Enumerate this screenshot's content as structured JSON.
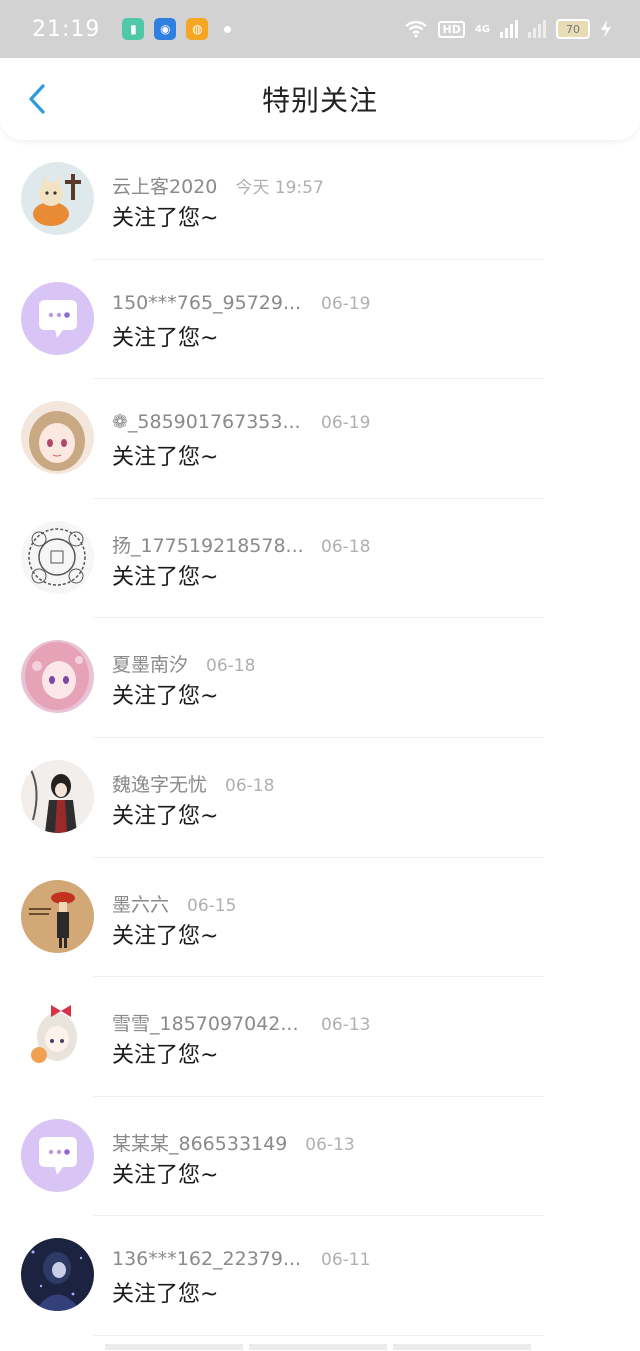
{
  "status_bar": {
    "time": "21:19",
    "network_label": "4G",
    "hd_label": "HD",
    "battery": "70"
  },
  "header": {
    "title": "特别关注"
  },
  "items": [
    {
      "name": "云上客2020",
      "time": "今天 19:57",
      "message": "关注了您~",
      "avatar": "cat-pumpkin"
    },
    {
      "name": "150***765_95729...",
      "time": "06-19",
      "message": "关注了您~",
      "avatar": "default-chat"
    },
    {
      "name": "❁_585901767353...",
      "time": "06-19",
      "message": "关注了您~",
      "avatar": "anime-girl"
    },
    {
      "name": "扬_177519218578...",
      "time": "06-18",
      "message": "关注了您~",
      "avatar": "pattern"
    },
    {
      "name": "夏墨南汐",
      "time": "06-18",
      "message": "关注了您~",
      "avatar": "anime-pink"
    },
    {
      "name": "魏逸字无忧",
      "time": "06-18",
      "message": "关注了您~",
      "avatar": "ink-figure"
    },
    {
      "name": "墨六六",
      "time": "06-15",
      "message": "关注了您~",
      "avatar": "beret-figure"
    },
    {
      "name": "雪雪_1857097042...",
      "time": "06-13",
      "message": "关注了您~",
      "avatar": "anime-bow"
    },
    {
      "name": "某某某_866533149",
      "time": "06-13",
      "message": "关注了您~",
      "avatar": "default-chat"
    },
    {
      "name": "136***162_22379...",
      "time": "06-11",
      "message": "关注了您~",
      "avatar": "dark-night"
    }
  ],
  "colors": {
    "status_bar": "#d2d2d2",
    "accent_back": "#2a9be0",
    "default_avatar": "#d8c4f5"
  }
}
